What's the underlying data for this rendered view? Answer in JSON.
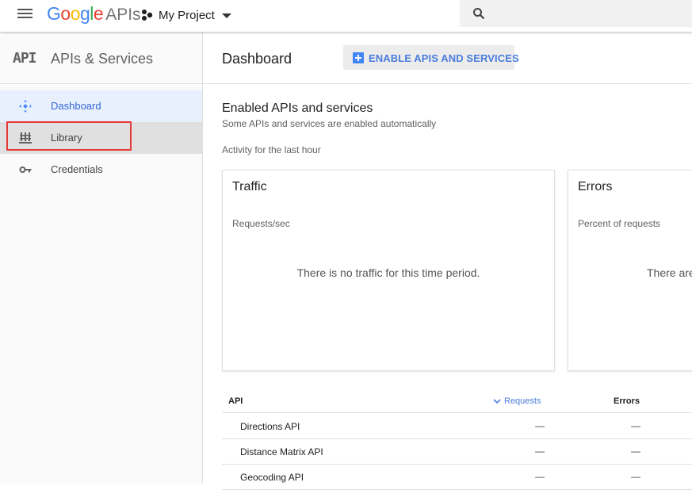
{
  "topbar": {
    "logo_google": [
      "G",
      "o",
      "o",
      "g",
      "l",
      "e"
    ],
    "logo_apis": "APIs",
    "project_name": "My Project",
    "search_placeholder": ""
  },
  "sidebar": {
    "mark": "API",
    "title": "APIs & Services",
    "items": [
      {
        "label": "Dashboard",
        "icon": "dashboard-icon",
        "active": true
      },
      {
        "label": "Library",
        "icon": "library-icon",
        "highlighted": true
      },
      {
        "label": "Credentials",
        "icon": "key-icon"
      }
    ]
  },
  "header": {
    "title": "Dashboard",
    "enable_button": "ENABLE APIS AND SERVICES"
  },
  "main": {
    "section_title": "Enabled APIs and services",
    "section_subtitle": "Some APIs and services are enabled automatically",
    "activity_label": "Activity for the last hour",
    "cards": [
      {
        "title": "Traffic",
        "subtitle": "Requests/sec",
        "message": "There is no traffic for this time period."
      },
      {
        "title": "Errors",
        "subtitle": "Percent of requests",
        "message": "There are"
      }
    ]
  },
  "table": {
    "columns": {
      "api": "API",
      "requests": "Requests",
      "errors": "Errors"
    },
    "rows": [
      {
        "name": "Directions API",
        "requests": "—",
        "errors": "—"
      },
      {
        "name": "Distance Matrix API",
        "requests": "—",
        "errors": "—"
      },
      {
        "name": "Geocoding API",
        "requests": "—",
        "errors": "—"
      }
    ]
  },
  "colors": {
    "accent": "#4285f4",
    "active_text": "#3367d6",
    "highlight": "#e53935"
  }
}
